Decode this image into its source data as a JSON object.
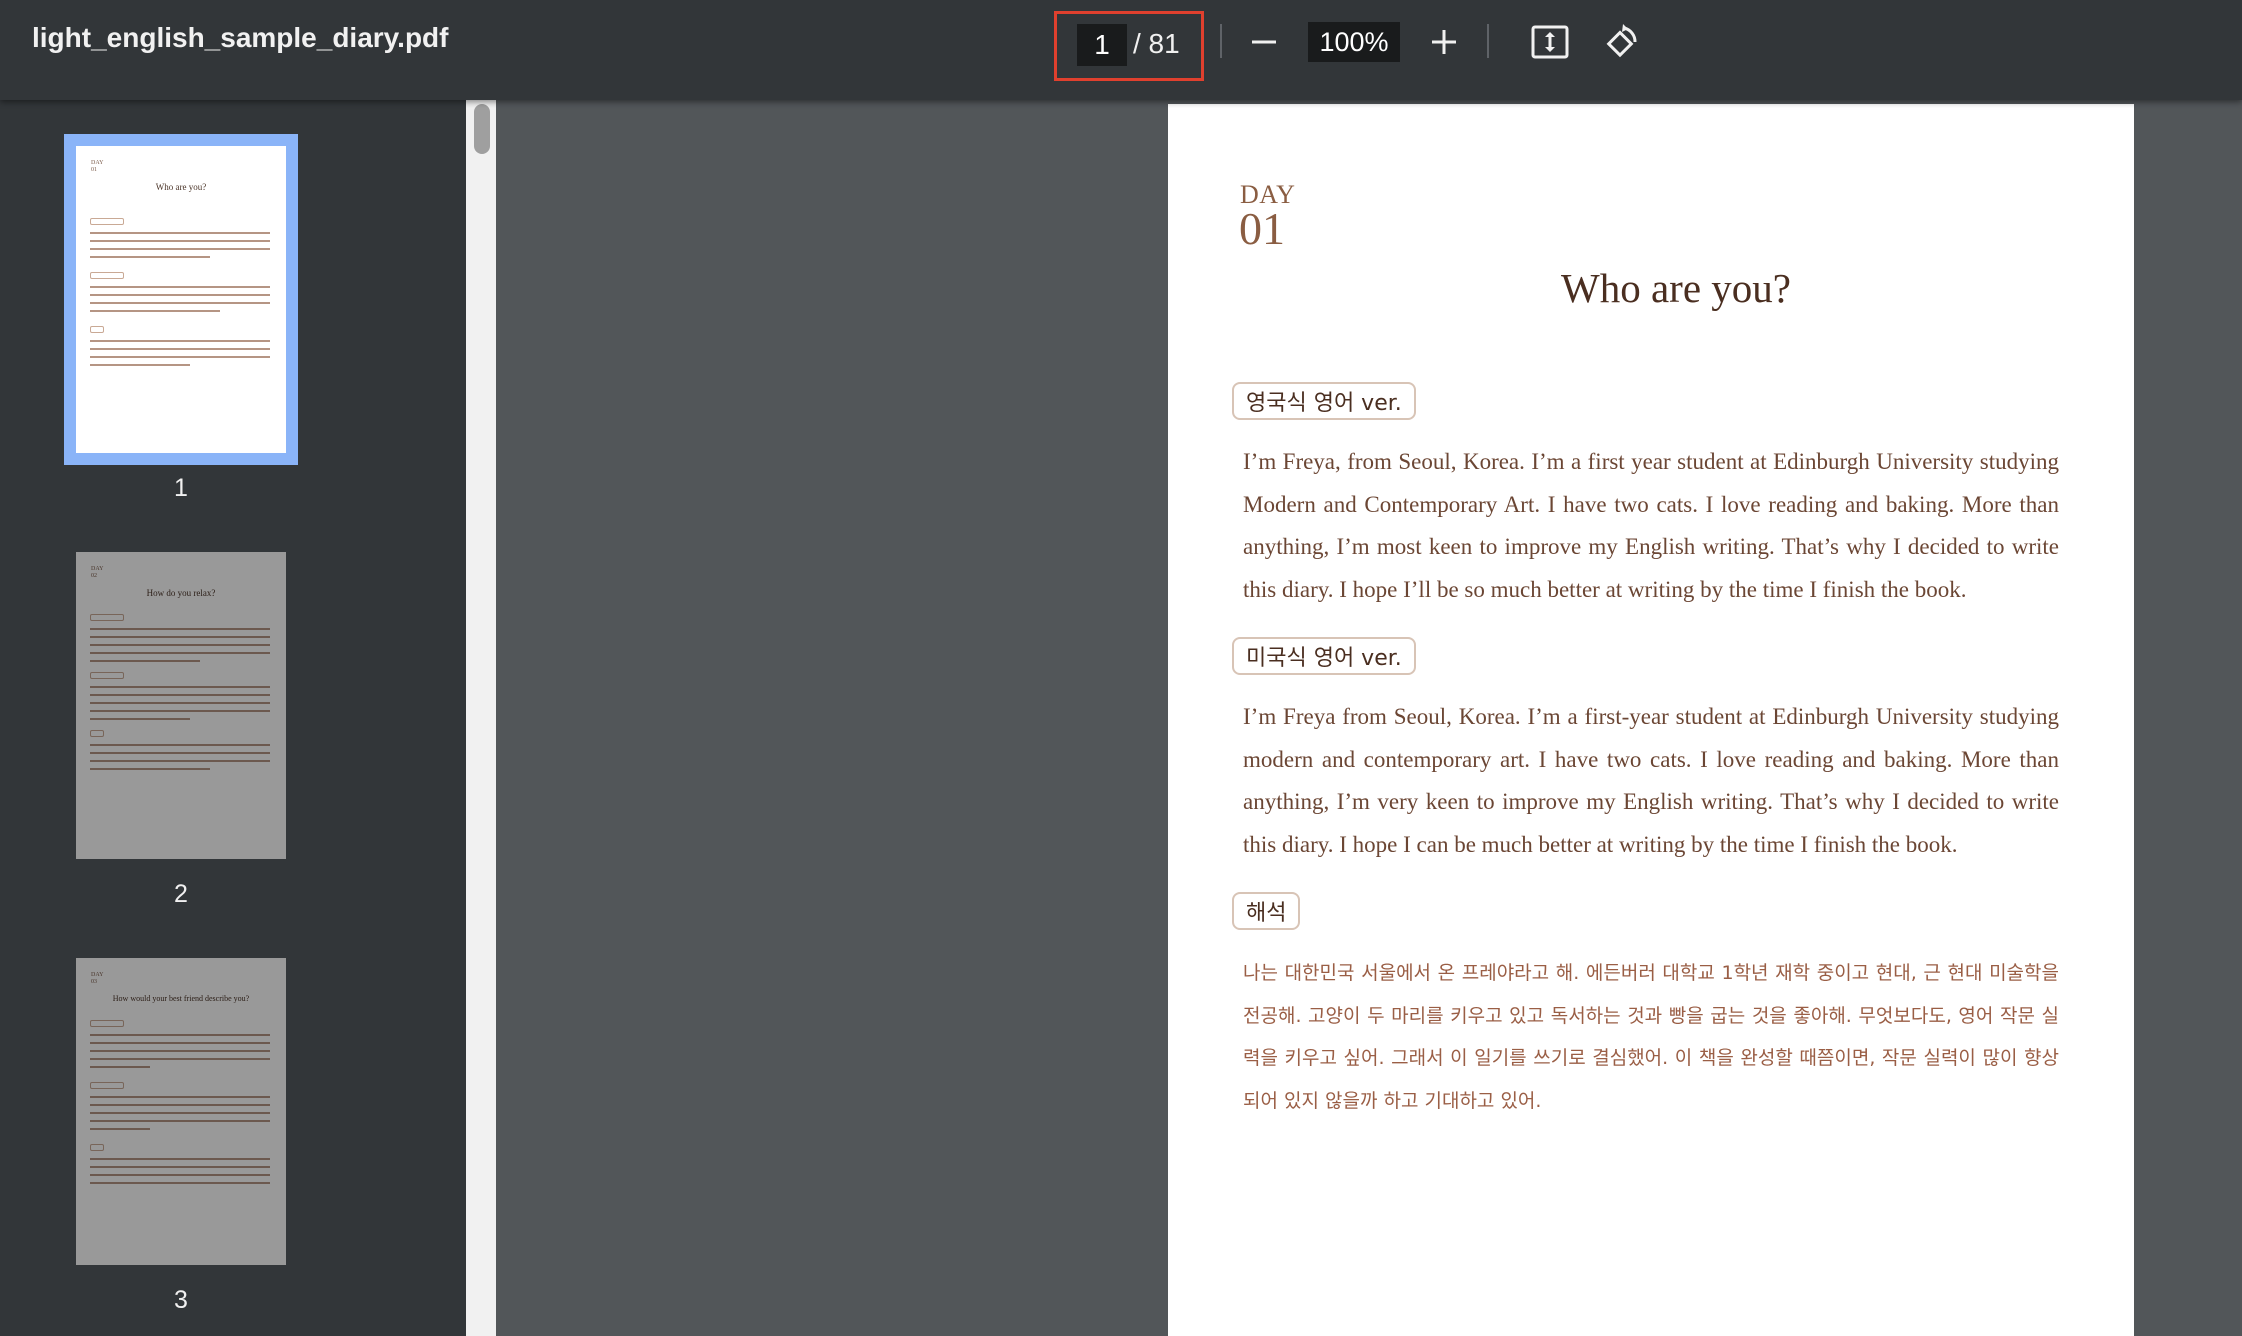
{
  "toolbar": {
    "file_title": "light_english_sample_diary.pdf",
    "current_page": "1",
    "total_pages": "/ 81",
    "zoom": "100%",
    "icons": [
      "minus-icon",
      "plus-icon",
      "fit-page-icon",
      "rotate-icon"
    ]
  },
  "sidebar": {
    "thumbnails": [
      {
        "label": "1",
        "mini_day": "DAY",
        "mini_num": "01",
        "mini_title": "Who are you?"
      },
      {
        "label": "2",
        "mini_day": "DAY",
        "mini_num": "02",
        "mini_title": "How do you relax?"
      },
      {
        "label": "3",
        "mini_day": "DAY",
        "mini_num": "03",
        "mini_title": "How would your best friend describe you?"
      }
    ]
  },
  "document": {
    "day_label": "DAY",
    "day_number": "01",
    "title": "Who are you?",
    "sections": [
      {
        "tag": "영국식 영어 ver.",
        "text": "I’m Freya, from Seoul, Korea. I’m a first year student at Edinburgh University studying Modern and Contemporary Art. I have two cats. I love reading and baking. More than anything, I’m most keen to improve my English writing. That’s why I decided to write this diary. I hope I’ll be so much better at writing by the time I finish the book."
      },
      {
        "tag": "미국식 영어 ver.",
        "text": "I’m Freya from Seoul, Korea. I’m a first-year student at Edinburgh University studying modern and contemporary art. I have two cats. I love reading and baking. More than anything, I’m very keen to improve my English writing. That’s why I decided to write this diary. I hope I can be much better at writing by the time I finish the book."
      },
      {
        "tag": "해석",
        "text": "나는 대한민국 서울에서 온 프레야라고 해. 에든버러 대학교 1학년 재학 중이고 현대, 근 현대 미술학을 전공해. 고양이 두 마리를 키우고 있고 독서하는 것과 빵을 굽는 것을 좋아해. 무엇보다도, 영어 작문 실력을 키우고 싶어. 그래서 이 일기를 쓰기로 결심했어. 이 책을 완성할 때쯤이면, 작문 실력이 많이 향상되어 있지 않을까 하고 기대하고 있어."
      }
    ]
  }
}
